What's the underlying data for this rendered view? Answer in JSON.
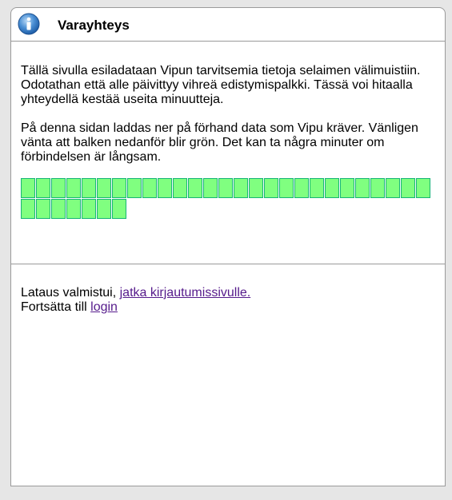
{
  "header": {
    "title": "Varayhteys",
    "icon": "info-icon"
  },
  "intro": {
    "fi": "Tällä sivulla esiladataan Vipun tarvitsemia tietoja selaimen välimuistiin. Odotathan että alle päivittyy vihreä edistymispalkki. Tässä voi hitaalla yhteydellä kestää useita minuutteja.",
    "sv": "På denna sidan laddas ner på förhand data som Vipu kräver. Vänligen vänta att balken nedanför blir grön. Det kan ta några minuter om förbindelsen är långsam."
  },
  "progress": {
    "completed_blocks": 34,
    "color": "#80ff80",
    "border_color": "#15b575"
  },
  "footer": {
    "fi_text": "Lataus valmistui, ",
    "fi_link": "jatka kirjautumissivulle.",
    "sv_text": "Fortsätta till ",
    "sv_link": "login",
    "link_color": "#551a8b"
  }
}
